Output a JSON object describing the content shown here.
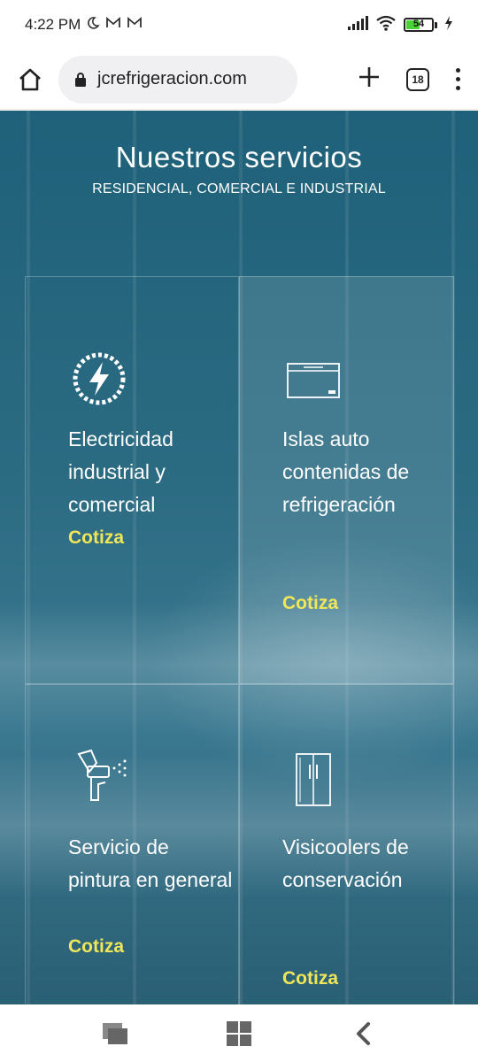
{
  "status_bar": {
    "time": "4:22 PM",
    "battery": "54"
  },
  "browser": {
    "url": "jcrefrigeracion.com",
    "tab_count": "18"
  },
  "hero": {
    "title": "Nuestros servicios",
    "subtitle": "RESIDENCIAL, COMERCIAL E INDUSTRIAL"
  },
  "services": [
    {
      "icon": "lightning-icon",
      "text": "Electricidad industrial y comercial",
      "cta": "Cotiza"
    },
    {
      "icon": "freezer-chest-icon",
      "text": "Islas auto contenidas de refrigeración",
      "cta": "Cotiza"
    },
    {
      "icon": "spray-gun-icon",
      "text": "Servicio de pintura en general",
      "cta": "Cotiza"
    },
    {
      "icon": "fridge-icon",
      "text": "Visicoolers de conservación",
      "cta": "Cotiza"
    }
  ],
  "colors": {
    "cta": "#f0e65a",
    "hero_bg": "#2b6b82"
  }
}
